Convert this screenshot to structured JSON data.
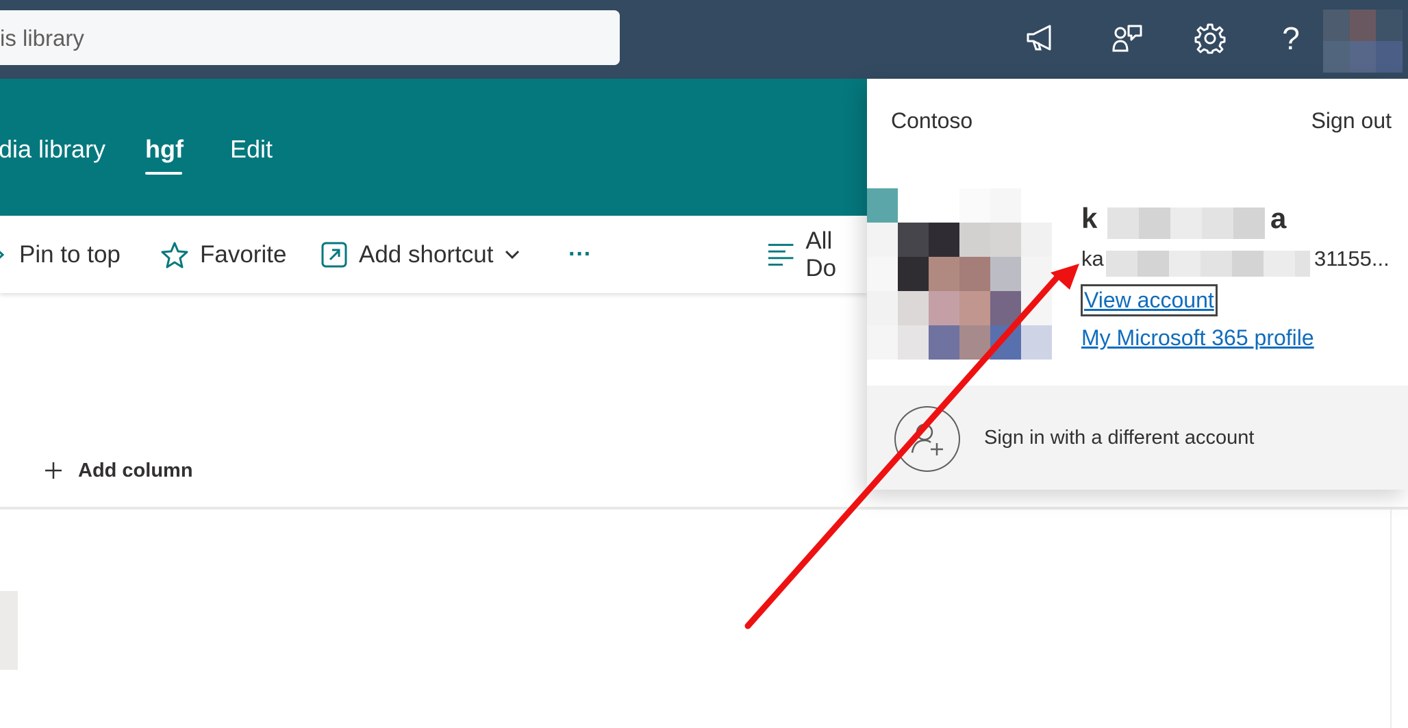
{
  "suitebar": {
    "search_text": "is library",
    "icons": {
      "announcement": "megaphone-icon",
      "feedback": "feedback-icon",
      "settings": "gear-icon",
      "help": "help-icon"
    },
    "help_glyph": "?"
  },
  "site_nav": {
    "items": [
      {
        "label": "dia library"
      },
      {
        "label": "hgf"
      },
      {
        "label": "Edit"
      }
    ]
  },
  "command_bar": {
    "pin_to_top": "Pin to top",
    "favorite": "Favorite",
    "add_shortcut": "Add shortcut",
    "more": "···",
    "view": "All Do"
  },
  "list": {
    "add_column": "Add column"
  },
  "account_flyout": {
    "org": "Contoso",
    "sign_out": "Sign out",
    "name_start": "k",
    "name_end": "a",
    "email_start": "ka",
    "email_end": "31155...",
    "view_account": "View account",
    "m365_profile": "My Microsoft 365 profile",
    "sign_in_different": "Sign in with a different account"
  },
  "colors": {
    "suitebar": "#334a61",
    "site_header": "#05787d",
    "link": "#0f6cbd",
    "annotation_arrow": "#ee1111"
  }
}
